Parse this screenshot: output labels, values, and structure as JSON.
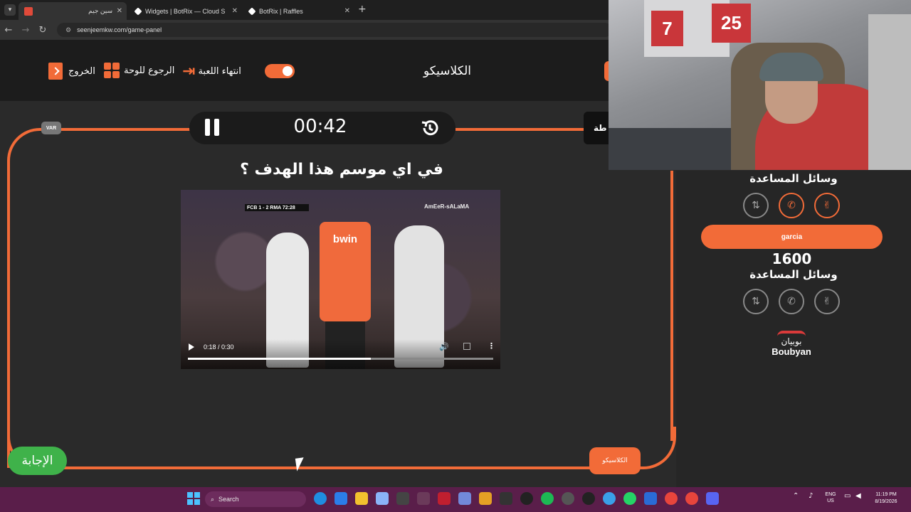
{
  "browser": {
    "tabs": [
      {
        "label": "سين جيم",
        "active": true,
        "color": "#e04a3a"
      },
      {
        "label": "Widgets | BotRix — Cloud Strea",
        "active": false,
        "color": "#ffffff"
      },
      {
        "label": "BotRix | Raffles",
        "active": false,
        "color": "#ffffff"
      }
    ],
    "new_tab": "+",
    "url": "seenjeemkw.com/game-panel"
  },
  "header": {
    "brand": "الكلاسيكو",
    "exit_label": "الخروج",
    "back_to_board_label": "الرجوع للوحة",
    "end_game_label": "انتهاء اللعبة"
  },
  "board": {
    "var_label": "VAR",
    "timer": "00:42",
    "score_tab": "طة",
    "question": "في اي موسم هذا الهدف ؟",
    "answer_label": "الإجابة",
    "category_label": "الكلاسيكو"
  },
  "video": {
    "scoreboard": "FCB 1 - 2 RMA 72:28",
    "watermark": "AmEeR-sALaMA",
    "shirt_text": "bwin",
    "time": "0:18 / 0:30",
    "progress": 0.6
  },
  "right_panel": {
    "lifelines_title_1": "وسائل المساعدة",
    "player_name": "garcia",
    "points": "1600",
    "lifelines_title_2": "وسائل المساعدة",
    "sponsor_arabic": "بوبيان",
    "sponsor_latin": "Boubyan"
  },
  "webcam": {
    "jersey_numbers": [
      "7",
      "25"
    ]
  },
  "taskbar": {
    "search_placeholder": "Search",
    "lang_1": "ENG",
    "lang_2": "US",
    "time": "11:19 PM",
    "date": "8/19/2026"
  },
  "colors": {
    "accent": "#f26b38",
    "answer": "#3fb24a",
    "background": "#2a2a2a"
  }
}
